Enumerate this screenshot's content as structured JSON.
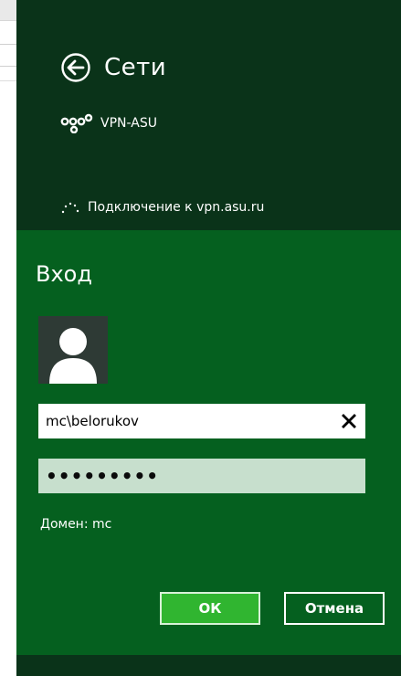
{
  "network": {
    "title": "Сети",
    "vpn_name": "VPN-ASU",
    "connecting_text": "Подключение к vpn.asu.ru"
  },
  "login": {
    "title": "Вход",
    "username_value": "mc\\belorukov",
    "password_masked": "•••••••••",
    "domain_text": "Домен: mc",
    "ok_label": "ОК",
    "cancel_label": "Отмена"
  },
  "icons": {
    "back": "back-arrow-circle-icon",
    "vpn": "vpn-link-icon",
    "spinner": "loading-dots-icon",
    "avatar": "user-silhouette-icon",
    "clear": "close-x-icon"
  },
  "colors": {
    "panel_dark": "#0a3319",
    "login_green": "#05601f",
    "ok_button": "#30b530",
    "password_field": "#c7dfcd"
  }
}
